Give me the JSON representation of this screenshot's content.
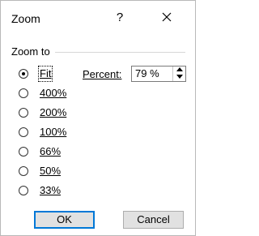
{
  "dialog": {
    "title": "Zoom",
    "help_label": "?",
    "close_icon": "close-icon"
  },
  "zoom_to": {
    "label": "Zoom to",
    "options": [
      {
        "label": "Fit",
        "selected": true
      },
      {
        "label": "400%",
        "selected": false
      },
      {
        "label": "200%",
        "selected": false
      },
      {
        "label": "100%",
        "selected": false
      },
      {
        "label": "66%",
        "selected": false
      },
      {
        "label": "50%",
        "selected": false
      },
      {
        "label": "33%",
        "selected": false
      }
    ],
    "percent_label": "Percent:",
    "percent_value": "79 %"
  },
  "buttons": {
    "ok": "OK",
    "cancel": "Cancel"
  },
  "colors": {
    "accent": "#0078d7",
    "button_bg": "#e1e1e1",
    "border": "#adadad"
  }
}
